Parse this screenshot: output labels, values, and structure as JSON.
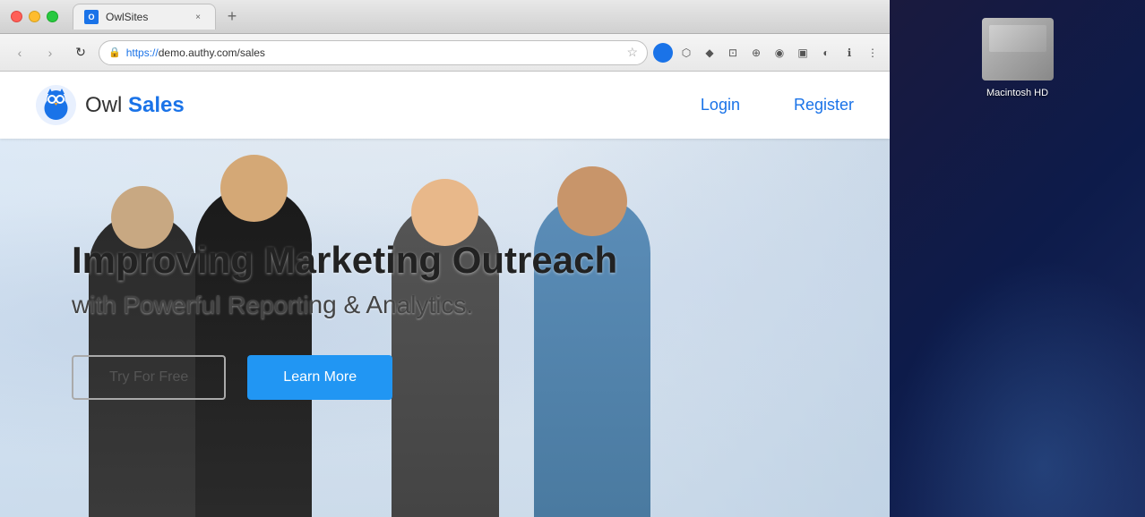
{
  "browser": {
    "title": "OwlSites",
    "url_display": "https://demo.authy.com/sales",
    "url_https": "https://",
    "url_rest": "demo.authy.com/sales",
    "tab_close_label": "×",
    "favicon_label": "O"
  },
  "nav_buttons": {
    "back": "‹",
    "forward": "›",
    "refresh": "↻"
  },
  "toolbar_icons": [
    "●",
    "✦",
    "◆",
    "■",
    "▣",
    "⊕",
    "◉",
    "○",
    "ℹ",
    "⋮"
  ],
  "site": {
    "logo_text": "Owl ",
    "logo_bold": "Sales",
    "nav": {
      "login": "Login",
      "register": "Register"
    },
    "hero": {
      "title_line1": "Improving Marketing Outreach",
      "title_line2": "with Powerful Reporting & Analytics.",
      "btn_free": "Try For Free",
      "btn_learn": "Learn More"
    }
  },
  "desktop": {
    "hd_label": "Macintosh HD"
  }
}
